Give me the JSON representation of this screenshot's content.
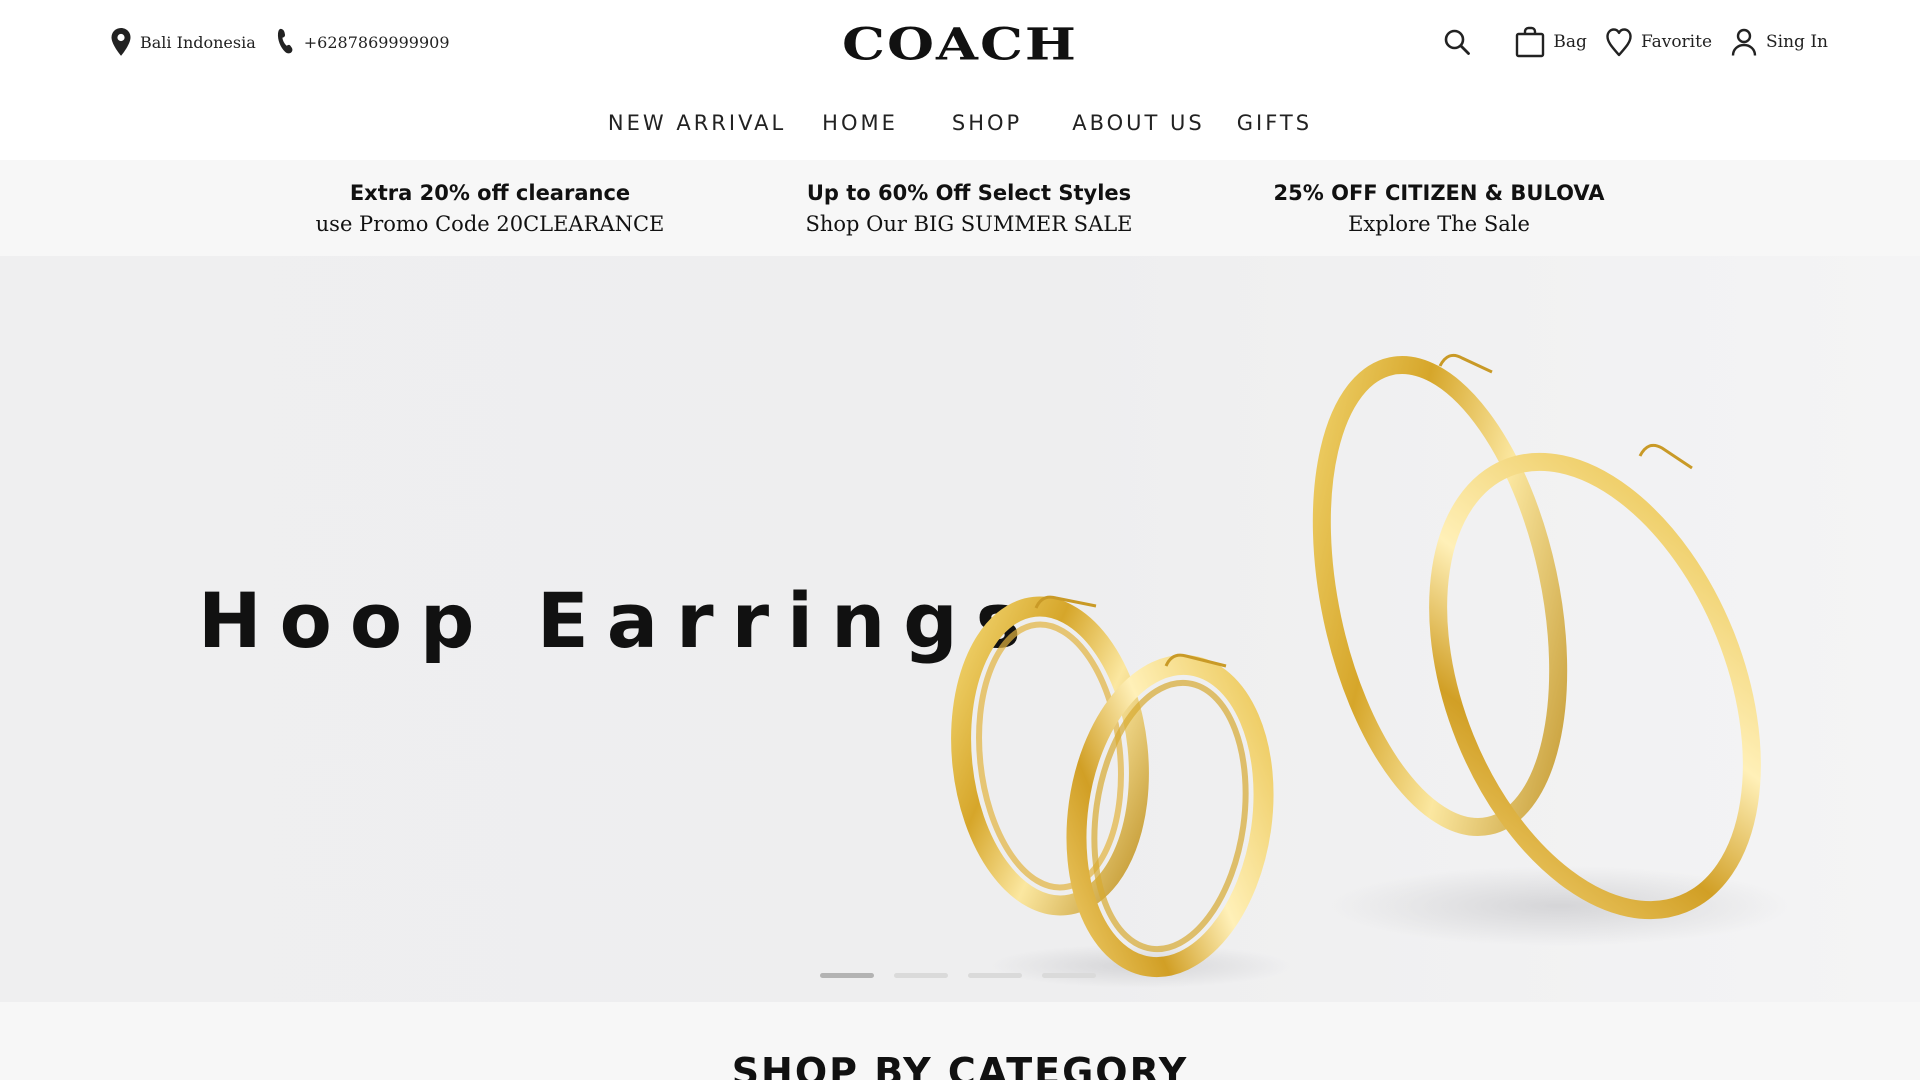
{
  "header": {
    "location": "Bali Indonesia",
    "phone": "+6287869999909",
    "logo": "COACH",
    "bag_label": "Bag",
    "favorite_label": "Favorite",
    "signin_label": "Sing In"
  },
  "nav": {
    "items": [
      {
        "label": "NEW ARRIVAL"
      },
      {
        "label": "HOME"
      },
      {
        "label": "SHOP"
      },
      {
        "label": "ABOUT US"
      },
      {
        "label": "GIFTS"
      }
    ]
  },
  "promos": [
    {
      "title": "Extra 20% off clearance",
      "subtitle": "use Promo Code 20CLEARANCE"
    },
    {
      "title": "Up to 60% Off Select Styles",
      "subtitle": "Shop Our BIG SUMMER SALE"
    },
    {
      "title": "25% OFF CITIZEN & BULOVA",
      "subtitle": "Explore The Sale"
    }
  ],
  "hero": {
    "title": "Hoop Earrings",
    "slide_count": 4,
    "active_slide": 1
  },
  "category": {
    "title": "SHOP BY CATEGORY"
  },
  "colors": {
    "text": "#111111",
    "promo_bg": "#f7f7f7",
    "hero_bg": "#eeeeef",
    "gold": "#d4a62a"
  },
  "icons": {
    "location": "map-pin-icon",
    "phone": "phone-icon",
    "search": "search-icon",
    "bag": "shopping-bag-icon",
    "favorite": "heart-icon",
    "signin": "user-icon"
  }
}
